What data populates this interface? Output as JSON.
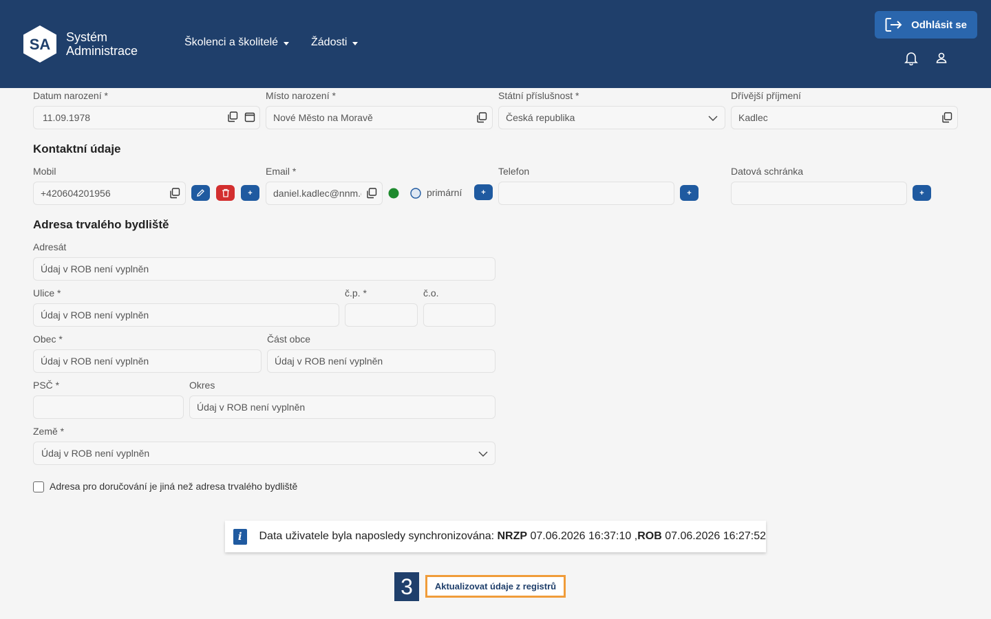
{
  "header": {
    "logo_abbr": "SA",
    "logo_line1": "Systém",
    "logo_line2": "Administrace",
    "nav": [
      {
        "label": "Školenci a školitelé"
      },
      {
        "label": "Žádosti"
      }
    ],
    "logout_label": "Odhlásit se"
  },
  "personal": {
    "birth_date": {
      "label": "Datum narození *",
      "value": "11.09.1978"
    },
    "birth_place": {
      "label": "Místo narození *",
      "value": "Nové Město na Moravě"
    },
    "citizenship": {
      "label": "Státní příslušnost *",
      "value": "Česká republika"
    },
    "former_surname": {
      "label": "Dřívější příjmení",
      "value": "Kadlec"
    }
  },
  "contact": {
    "title": "Kontaktní údaje",
    "mobile": {
      "label": "Mobil",
      "value": "+420604201956"
    },
    "email": {
      "label": "Email *",
      "value": "daniel.kadlec@nnm.c",
      "primary_label": "primární"
    },
    "phone": {
      "label": "Telefon",
      "value": ""
    },
    "data_box": {
      "label": "Datová schránka",
      "value": ""
    }
  },
  "address": {
    "title": "Adresa trvalého bydliště",
    "recipient": {
      "label": "Adresát",
      "value": "Údaj v ROB není vyplněn"
    },
    "street": {
      "label": "Ulice *",
      "value": "Údaj v ROB není vyplněn"
    },
    "cp": {
      "label": "č.p. *",
      "value": ""
    },
    "co": {
      "label": "č.o.",
      "value": ""
    },
    "city": {
      "label": "Obec *",
      "value": "Údaj v ROB není vyplněn"
    },
    "city_part": {
      "label": "Část obce",
      "value": "Údaj v ROB není vyplněn"
    },
    "zip": {
      "label": "PSČ *",
      "value": ""
    },
    "district": {
      "label": "Okres",
      "value": "Údaj v ROB není vyplněn"
    },
    "country": {
      "label": "Země *",
      "value": "Údaj v ROB není vyplněn"
    },
    "different_delivery": "Adresa pro doručování je jiná než adresa trvalého bydliště"
  },
  "sync": {
    "prefix": "Data uživatele byla naposledy synchronizována: ",
    "nrzp_label": "NRZP",
    "nrzp_time": " 07.06.2026 16:37:10 ,",
    "rob_label": "ROB",
    "rob_time": " 07.06.2026 16:27:52"
  },
  "step_number": "3",
  "update_button": "Aktualizovat údaje z registrů",
  "colors": {
    "header": "#1f3f6b",
    "primary": "#1f5aa0",
    "danger": "#d32f2f",
    "highlight": "#f09c3a",
    "status": "#1e8a2e"
  }
}
